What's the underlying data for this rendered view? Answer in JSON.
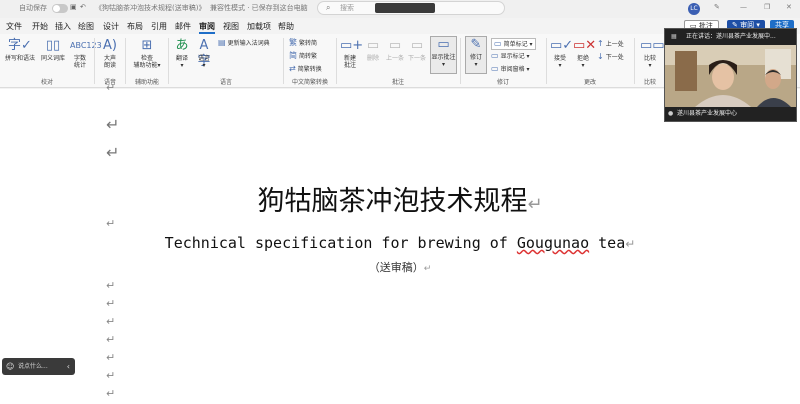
{
  "titlebar": {
    "autosave_label": "自动保存",
    "toggle_state": "关",
    "doc_name": "《狗牯脑茶冲泡技术规程(送审稿)》",
    "view_mode": "兼容性模式 · 已保存到这台电脑",
    "search_placeholder": "搜索",
    "avatar_initials": "LC"
  },
  "menu": {
    "tabs": [
      "文件",
      "开始",
      "插入",
      "绘图",
      "设计",
      "布局",
      "引用",
      "邮件",
      "审阅",
      "视图",
      "加载项",
      "帮助"
    ],
    "active": "审阅",
    "comment_button": "批注",
    "review_button": "审阅",
    "share_button": "共享"
  },
  "ribbon": {
    "proofing": {
      "spelling": "拼写和语法",
      "thesaurus": "同义词库",
      "word_count_line1": "字数",
      "word_count_line2": "统计",
      "group": "校对"
    },
    "speech": {
      "read_aloud_line1": "大声",
      "read_aloud_line2": "朗读",
      "group": "语音"
    },
    "accessibility": {
      "check_line1": "检查",
      "check_line2": "辅助功能",
      "group": "辅助功能"
    },
    "language": {
      "translate": "翻译",
      "language": "语言",
      "update_ime": "更新输入法词典",
      "group": "语言"
    },
    "chinese_conversion": {
      "to_traditional": "繁转简",
      "to_simplified": "简转繁",
      "conversion": "简繁转换",
      "group": "中文简繁转换"
    },
    "comments": {
      "new_line1": "新建",
      "new_line2": "批注",
      "delete": "删除",
      "previous": "上一条",
      "next": "下一条",
      "show": "显示批注",
      "group": "批注"
    },
    "tracking": {
      "track_changes": "修订",
      "simple_markup": "简单标记",
      "show_markup": "显示标记",
      "reviewing_pane": "审阅窗格",
      "group": "修订"
    },
    "changes": {
      "accept": "接受",
      "reject": "拒绝",
      "previous": "上一处",
      "next": "下一处",
      "group": "更改"
    },
    "compare": {
      "compare": "比较",
      "group": "比较"
    }
  },
  "document": {
    "title": "狗牯脑茶冲泡技术规程",
    "subtitle_before": "Technical specification for brewing of ",
    "subtitle_underlined": "Gougunao",
    "subtitle_after": " tea",
    "note": "（送审稿）",
    "paragraph_mark": "↵"
  },
  "video": {
    "speaker_text": "正在讲话：遂川县茶产业发展中...",
    "participant_name": "遂川县茶产业发展中心"
  },
  "chat": {
    "placeholder": "说点什么..."
  },
  "colors": {
    "accent": "#1e6ec8",
    "share": "#1e6ec8",
    "review": "#1e4fa6",
    "spell_underline": "#d33"
  }
}
